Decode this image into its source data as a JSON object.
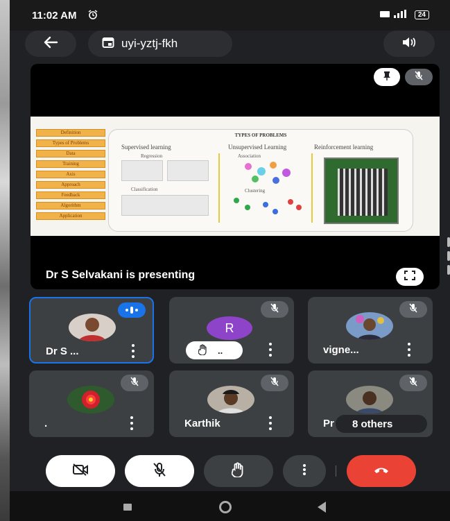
{
  "status_bar": {
    "time": "11:02 AM",
    "alarm_icon": "alarm-icon",
    "network": "4G",
    "battery": "24"
  },
  "topbar": {
    "meeting_code": "uyi-yztj-fkh",
    "back_icon": "arrow-back-icon",
    "calendar_icon": "calendar-icon",
    "audio_icon": "speaker-icon"
  },
  "presentation": {
    "presenter_label": "Dr S Selvakani is presenting",
    "slide": {
      "title": "TYPES OF PROBLEMS",
      "left_menu": [
        "Definition",
        "Types of Problems",
        "Data",
        "Training",
        "Axis",
        "Approach",
        "Feedback",
        "Algorithm",
        "Application"
      ],
      "columns": [
        "Supervised learning",
        "Unsupervised Learning",
        "Reinforcement learning"
      ],
      "sub_labels": [
        "Regression",
        "Classification",
        "Association",
        "Clustering"
      ]
    }
  },
  "participants": [
    {
      "name": "Dr S ...",
      "speaking": true,
      "muted": false
    },
    {
      "name": "",
      "initial": "R",
      "muted": true,
      "hand_raised": true,
      "hand_label": ".."
    },
    {
      "name": "vigne...",
      "muted": true
    },
    {
      "name": ".",
      "muted": true
    },
    {
      "name": "Karthik",
      "muted": true
    },
    {
      "name": "Pr",
      "muted": true,
      "others_label": "8 others"
    }
  ],
  "controls": {
    "camera": "camera-off-icon",
    "mic": "mic-off-icon",
    "hand": "raise-hand-icon",
    "more": "more-vert-icon",
    "end": "end-call-icon"
  },
  "colors": {
    "accent": "#1a73e8",
    "end_call": "#ea4335",
    "tile": "#3c4043",
    "background": "#202124"
  }
}
